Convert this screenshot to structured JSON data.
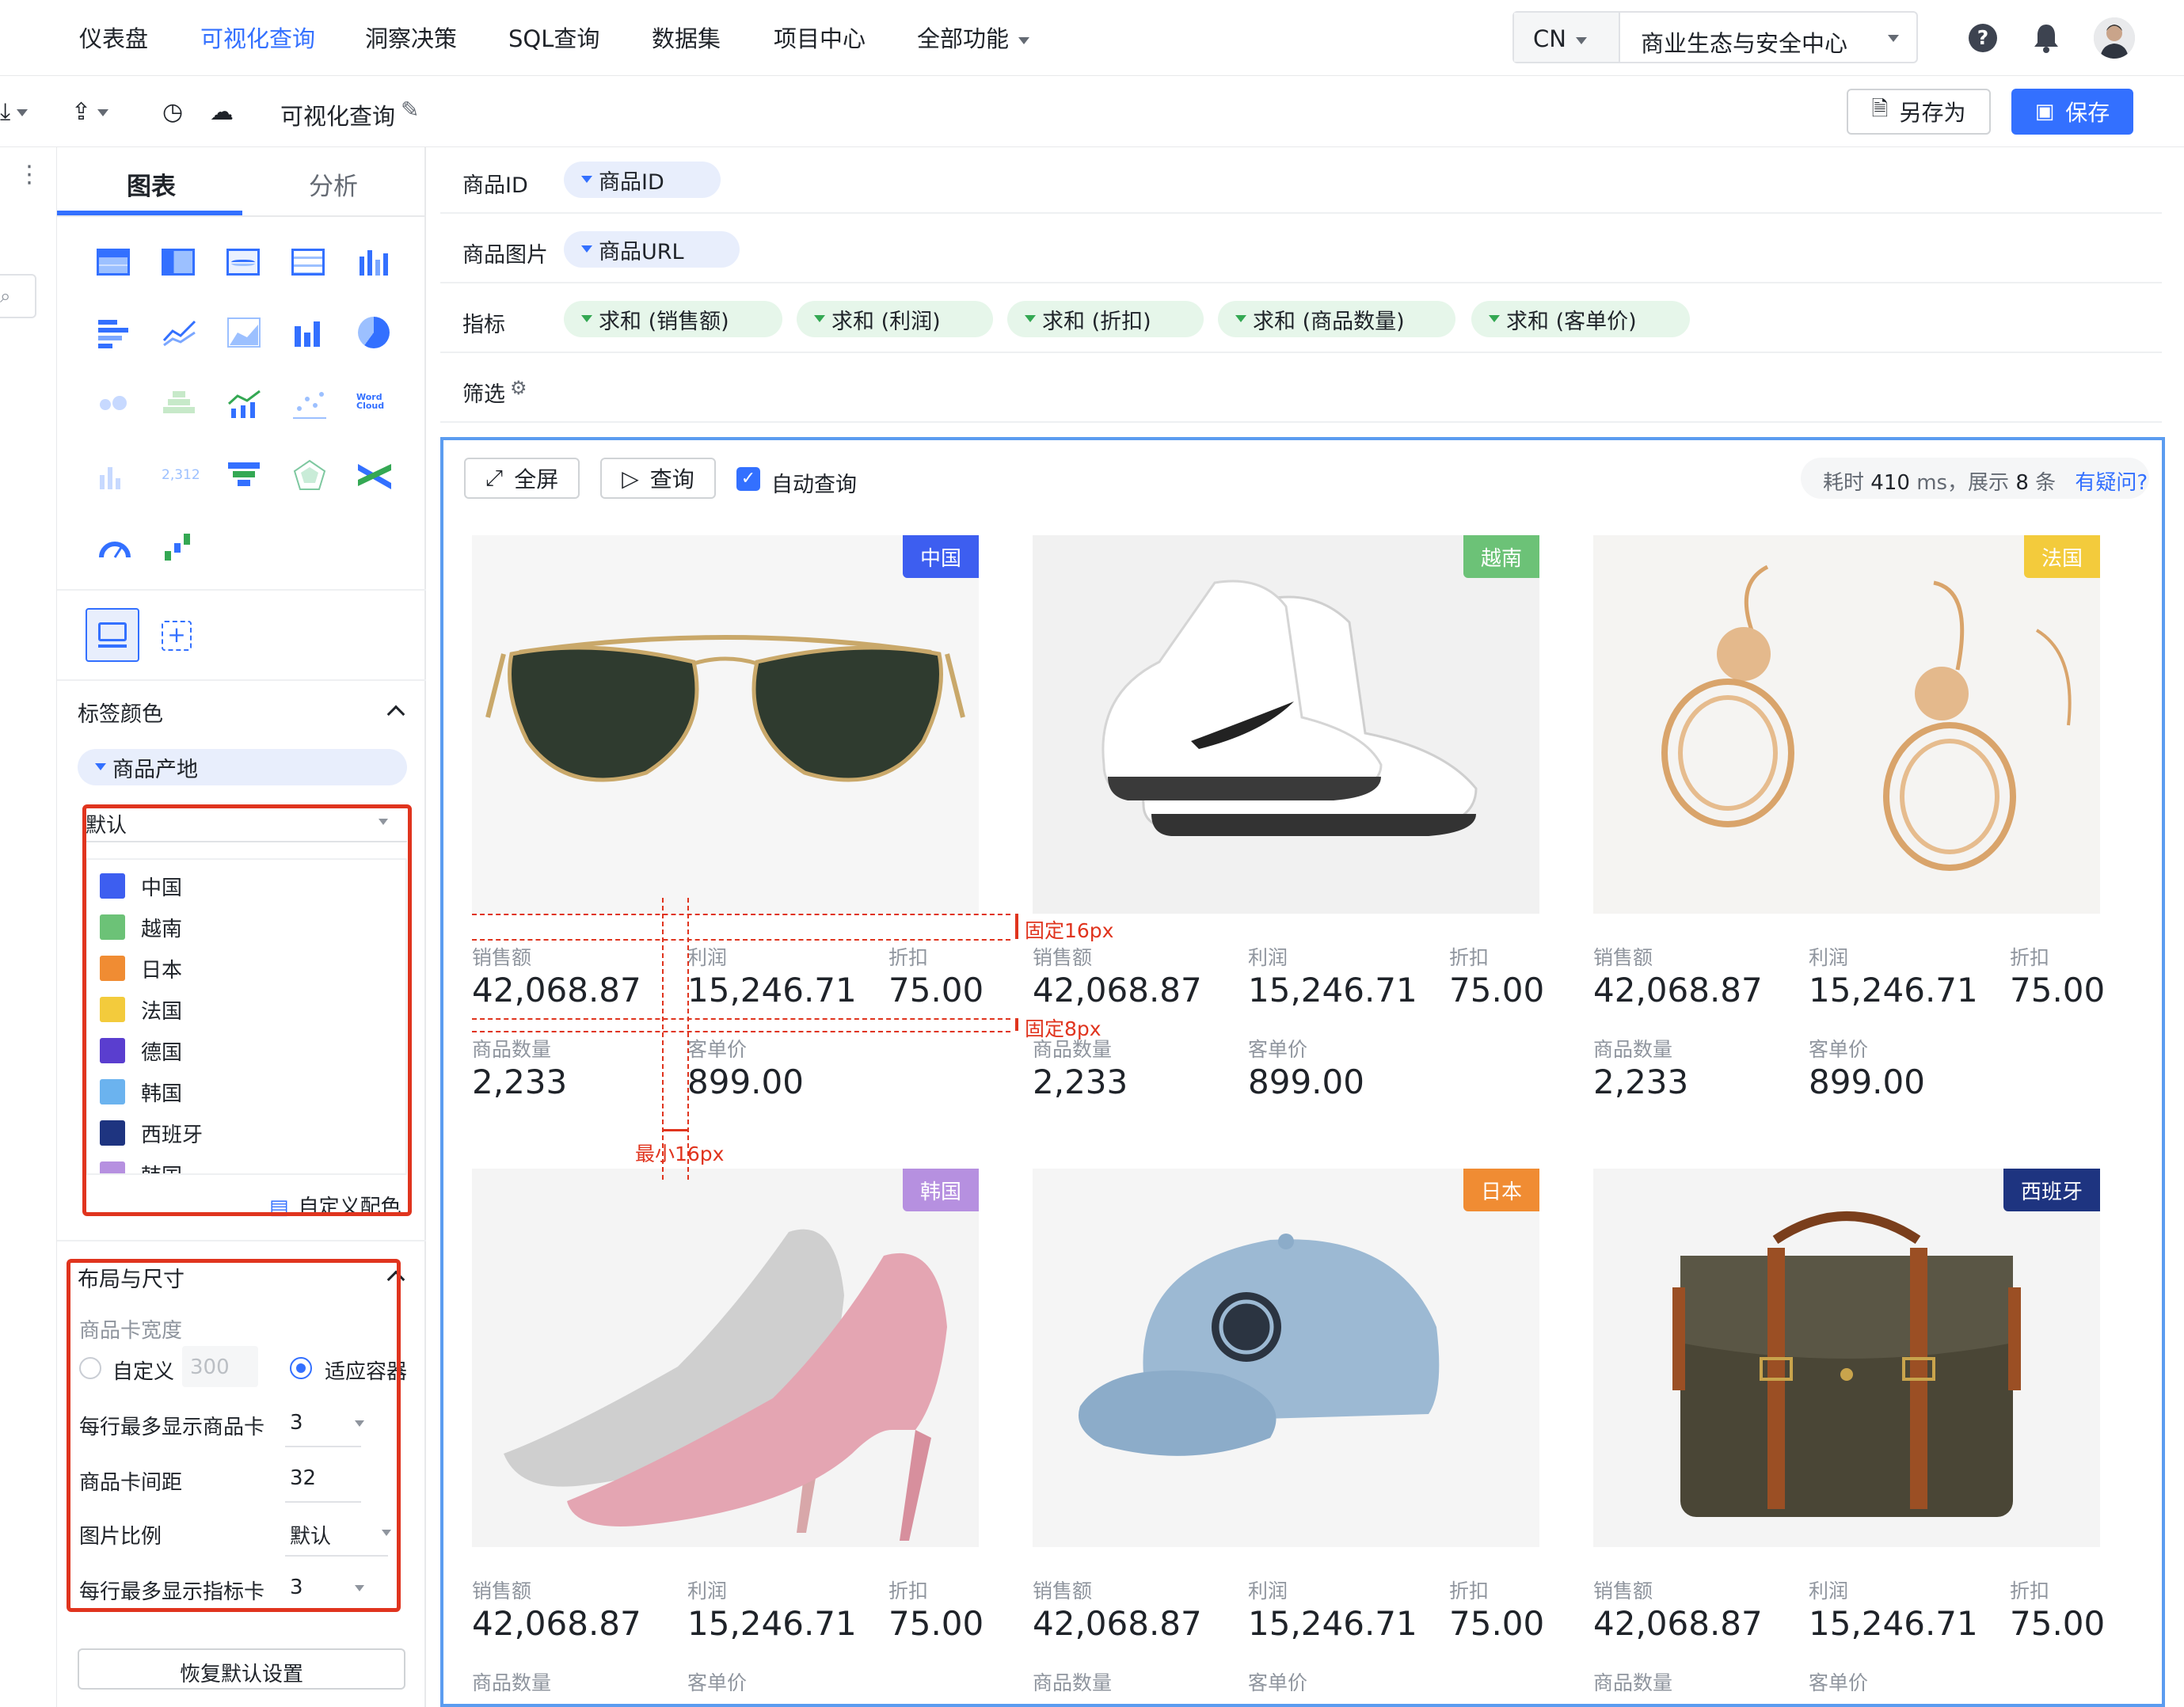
{
  "nav": {
    "items": [
      "仪表盘",
      "可视化查询",
      "洞察决策",
      "SQL查询",
      "数据集",
      "项目中心",
      "全部功能"
    ],
    "active_index": 1,
    "locale": "CN",
    "space": "商业生态与安全中心"
  },
  "toolbar": {
    "title": "可视化查询",
    "save_as": "另存为",
    "save": "保存"
  },
  "panel": {
    "tabs": [
      "图表",
      "分析"
    ],
    "active_tab": 0,
    "tag_color": {
      "title": "标签颜色",
      "field": "商品产地",
      "scheme": "默认",
      "legend": [
        {
          "label": "中国",
          "color": "#3d5ef0"
        },
        {
          "label": "越南",
          "color": "#6cc277"
        },
        {
          "label": "日本",
          "color": "#f08c33"
        },
        {
          "label": "法国",
          "color": "#f3cb3c"
        },
        {
          "label": "德国",
          "color": "#5a3ecf"
        },
        {
          "label": "韩国",
          "color": "#6bb3ef"
        },
        {
          "label": "西班牙",
          "color": "#1e3480"
        },
        {
          "label": "韩国",
          "color": "#b690e0"
        }
      ],
      "custom_color": "自定义配色"
    },
    "layout": {
      "title": "布局与尺寸",
      "card_width_label": "商品卡宽度",
      "custom_label": "自定义",
      "custom_value": "300",
      "fit_label": "适应容器",
      "per_row_label": "每行最多显示商品卡",
      "per_row_value": "3",
      "gap_label": "商品卡间距",
      "gap_value": "32",
      "ratio_label": "图片比例",
      "ratio_value": "默认",
      "metric_cards_label": "每行最多显示指标卡",
      "metric_cards_value": "3"
    },
    "reset": "恢复默认设置"
  },
  "config": {
    "product_id_label": "商品ID",
    "product_id_field": "商品ID",
    "product_img_label": "商品图片",
    "product_img_field": "商品URL",
    "metrics_label": "指标",
    "metrics": [
      "求和 (销售额)",
      "求和 (利润)",
      "求和 (折扣)",
      "求和 (商品数量)",
      "求和 (客单价)"
    ],
    "filter_label": "筛选"
  },
  "preview": {
    "fullscreen": "全屏",
    "query": "查询",
    "auto_query": "自动查询",
    "status_prefix": "耗时",
    "elapsed": "410",
    "status_mid": "ms，展示",
    "count": "8",
    "status_suffix": "条",
    "help_link": "有疑问?",
    "metric_labels": [
      "销售额",
      "利润",
      "折扣",
      "商品数量",
      "客单价"
    ],
    "cards": [
      {
        "badge": "中国",
        "badge_color": "#3d5ef0",
        "product": "sunglasses",
        "values": [
          "42,068.87",
          "15,246.71",
          "75.00",
          "2,233",
          "899.00"
        ]
      },
      {
        "badge": "越南",
        "badge_color": "#6cc277",
        "product": "sneaker",
        "values": [
          "42,068.87",
          "15,246.71",
          "75.00",
          "2,233",
          "899.00"
        ]
      },
      {
        "badge": "法国",
        "badge_color": "#f3cb3c",
        "product": "earrings",
        "values": [
          "42,068.87",
          "15,246.71",
          "75.00",
          "2,233",
          "899.00"
        ]
      },
      {
        "badge": "韩国",
        "badge_color": "#b690e0",
        "product": "heels",
        "values": [
          "42,068.87",
          "15,246.71",
          "75.00"
        ]
      },
      {
        "badge": "日本",
        "badge_color": "#f08c33",
        "product": "cap",
        "values": [
          "42,068.87",
          "15,246.71",
          "75.00"
        ]
      },
      {
        "badge": "西班牙",
        "badge_color": "#1e3480",
        "product": "backpack",
        "values": [
          "42,068.87",
          "15,246.71",
          "75.00"
        ]
      }
    ],
    "annotations": {
      "fixed16": "固定16px",
      "fixed8": "固定8px",
      "min16": "最小16px"
    }
  }
}
